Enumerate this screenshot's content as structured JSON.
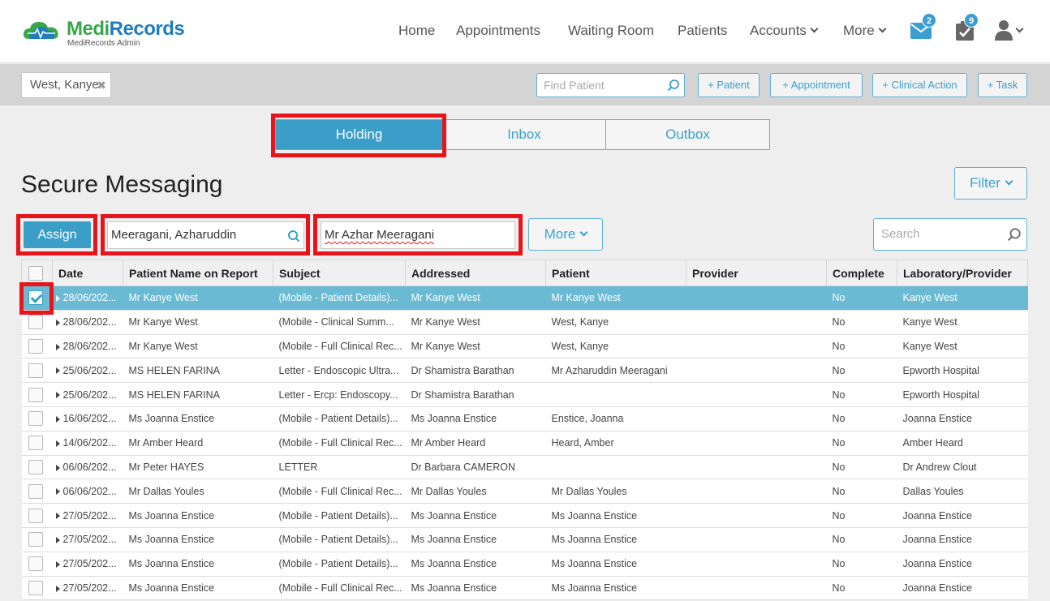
{
  "brand": {
    "name_a": "Medi",
    "name_b": "Records",
    "subtitle": "MediRecords Admin",
    "color_green": "#3aa64a",
    "color_blue": "#1f7cc0"
  },
  "nav": {
    "home": "Home",
    "appointments": "Appointments",
    "waiting_room": "Waiting Room",
    "patients": "Patients",
    "accounts": "Accounts",
    "more": "More"
  },
  "header_icons": {
    "mail_icon": "envelope-icon",
    "mail_count": "2",
    "tasks_icon": "clipboard-check-icon",
    "tasks_count": "9",
    "user_icon": "user-icon"
  },
  "patient_bar": {
    "current_patient": "West, Kanye",
    "find_placeholder": "Find Patient",
    "btn_patient": "+ Patient",
    "btn_appointment": "+ Appointment",
    "btn_clinical": "+ Clinical Action",
    "btn_task": "+ Task"
  },
  "tabs": {
    "holding": "Holding",
    "inbox": "Inbox",
    "outbox": "Outbox",
    "active": "Holding"
  },
  "page": {
    "title": "Secure Messaging",
    "filter": "Filter"
  },
  "toolbar": {
    "assign": "Assign",
    "patient_value": "Meeragani, Azharuddin",
    "addressed_value": "Mr Azhar Meeragani",
    "more": "More",
    "search_placeholder": "Search"
  },
  "table": {
    "columns": {
      "date": "Date",
      "patient_report": "Patient Name on Report",
      "subject": "Subject",
      "addressed": "Addressed",
      "patient": "Patient",
      "provider": "Provider",
      "complete": "Complete",
      "lab": "Laboratory/Provider"
    },
    "rows": [
      {
        "date": "28/06/202...",
        "report": "Mr Kanye West",
        "subject": "(Mobile - Patient Details)...",
        "addressed": "Mr Kanye West",
        "patient": "Mr Kanye West",
        "provider": "",
        "complete": "No",
        "lab": "Kanye West"
      },
      {
        "date": "28/06/202...",
        "report": "Mr Kanye West",
        "subject": "(Mobile - Clinical Summ...",
        "addressed": "Mr Kanye West",
        "patient": "West, Kanye",
        "provider": "",
        "complete": "No",
        "lab": "Kanye West"
      },
      {
        "date": "28/06/202...",
        "report": "Mr Kanye West",
        "subject": "(Mobile - Full Clinical Rec...",
        "addressed": "Mr Kanye West",
        "patient": "West, Kanye",
        "provider": "",
        "complete": "No",
        "lab": "Kanye West"
      },
      {
        "date": "25/06/202...",
        "report": "MS HELEN FARINA",
        "subject": "Letter - Endoscopic Ultra...",
        "addressed": "Dr Shamistra Barathan",
        "patient": "Mr Azharuddin Meeragani",
        "provider": "",
        "complete": "No",
        "lab": "Epworth Hospital"
      },
      {
        "date": "25/06/202...",
        "report": "MS HELEN FARINA",
        "subject": "Letter - Ercp: Endoscopy...",
        "addressed": "Dr Shamistra Barathan",
        "patient": "",
        "provider": "",
        "complete": "No",
        "lab": "Epworth Hospital"
      },
      {
        "date": "16/06/202...",
        "report": "Ms Joanna Enstice",
        "subject": "(Mobile - Patient Details)...",
        "addressed": "Ms Joanna Enstice",
        "patient": "Enstice, Joanna",
        "provider": "",
        "complete": "No",
        "lab": "Joanna Enstice"
      },
      {
        "date": "14/06/202...",
        "report": "Mr Amber Heard",
        "subject": "(Mobile - Full Clinical Rec...",
        "addressed": "Mr Amber Heard",
        "patient": "Heard, Amber",
        "provider": "",
        "complete": "No",
        "lab": "Amber Heard"
      },
      {
        "date": "06/06/202...",
        "report": "Mr Peter HAYES",
        "subject": "LETTER",
        "addressed": "Dr Barbara CAMERON",
        "patient": "",
        "provider": "",
        "complete": "No",
        "lab": "Dr Andrew Clout"
      },
      {
        "date": "06/06/202...",
        "report": "Mr Dallas Youles",
        "subject": "(Mobile - Full Clinical Rec...",
        "addressed": "Mr Dallas Youles",
        "patient": "Mr Dallas Youles",
        "provider": "",
        "complete": "No",
        "lab": "Dallas Youles"
      },
      {
        "date": "27/05/202...",
        "report": "Ms Joanna Enstice",
        "subject": "(Mobile - Patient Details)...",
        "addressed": "Ms Joanna Enstice",
        "patient": "Ms Joanna Enstice",
        "provider": "",
        "complete": "No",
        "lab": "Joanna Enstice"
      },
      {
        "date": "27/05/202...",
        "report": "Ms Joanna Enstice",
        "subject": "(Mobile - Patient Details)...",
        "addressed": "Ms Joanna Enstice",
        "patient": "Ms Joanna Enstice",
        "provider": "",
        "complete": "No",
        "lab": "Joanna Enstice"
      },
      {
        "date": "27/05/202...",
        "report": "Ms Joanna Enstice",
        "subject": "(Mobile - Patient Details)...",
        "addressed": "Ms Joanna Enstice",
        "patient": "Ms Joanna Enstice",
        "provider": "",
        "complete": "No",
        "lab": "Joanna Enstice"
      },
      {
        "date": "27/05/202...",
        "report": "Ms Joanna Enstice",
        "subject": "(Mobile - Full Clinical Rec...",
        "addressed": "Ms Joanna Enstice",
        "patient": "Ms Joanna Enstice",
        "provider": "",
        "complete": "No",
        "lab": "Joanna Enstice"
      }
    ],
    "selected_row": 0
  },
  "colors": {
    "accent": "#3a9ec9",
    "selected_row": "#6bbad4",
    "highlight": "#e8141b"
  }
}
